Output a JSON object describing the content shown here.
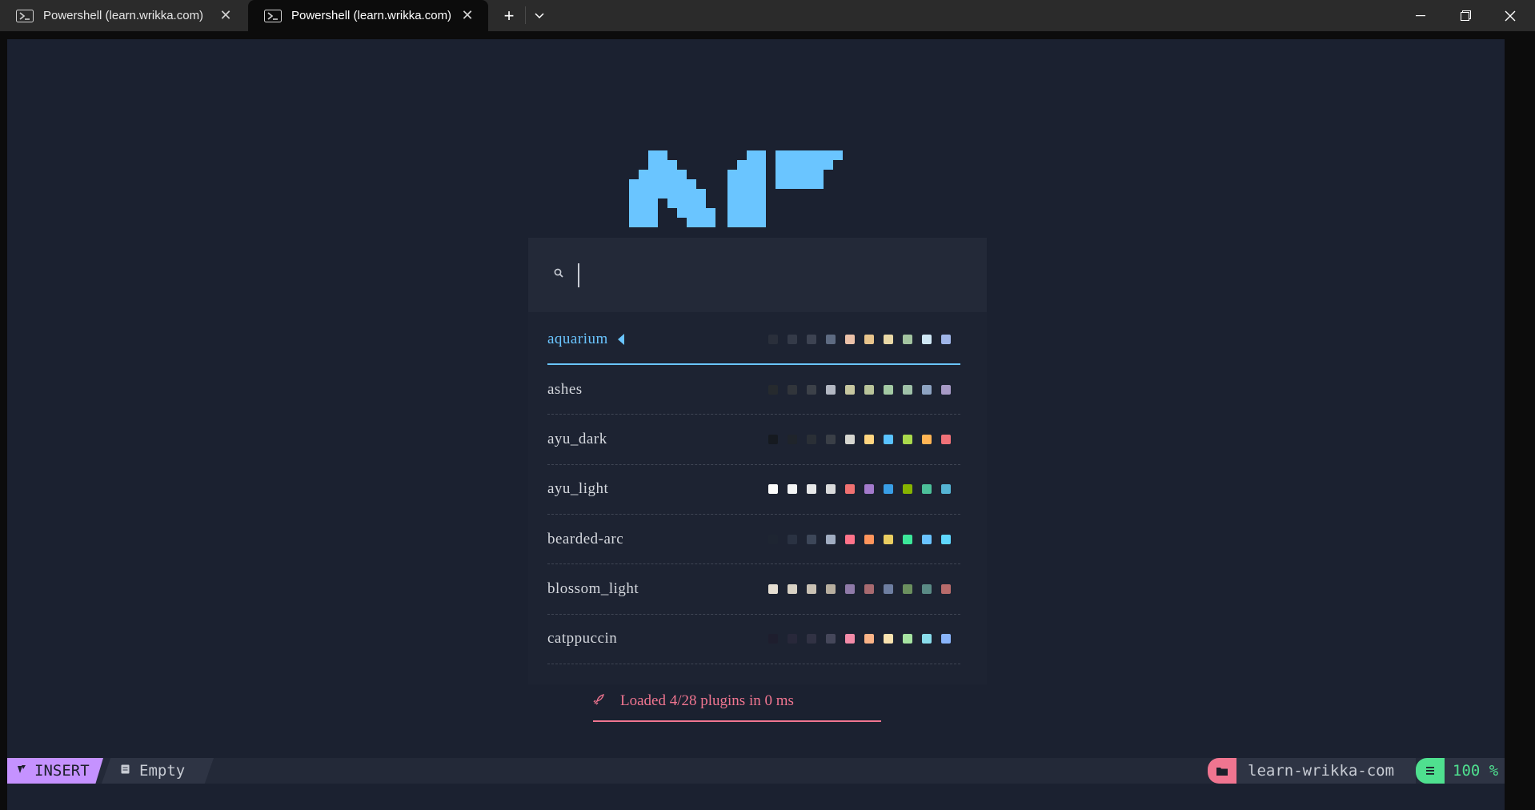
{
  "window": {
    "tabs": [
      {
        "label": "Powershell (learn.wrikka.com)",
        "active": false
      },
      {
        "label": "Powershell (learn.wrikka.com)",
        "active": true
      }
    ],
    "new_tab_icon": "+",
    "dropdown_icon": "chevron-down",
    "minimize_icon": "minimize",
    "restore_icon": "restore",
    "close_icon": "close"
  },
  "picker": {
    "prompt_icon": "search-icon",
    "prompt_value": "",
    "results": [
      {
        "name": "aquarium",
        "selected": true,
        "colors": [
          "#2a2f3b",
          "#343a48",
          "#3d4352",
          "#5e6b82",
          "#ebc1a9",
          "#e8c48c",
          "#e9d8a6",
          "#a3c4a0",
          "#cfe7f5",
          "#9fb5e8"
        ]
      },
      {
        "name": "ashes",
        "selected": false,
        "colors": [
          "#262a2e",
          "#31353b",
          "#3c4149",
          "#b3b8c3",
          "#c7c7a0",
          "#b9c49a",
          "#a3c9a3",
          "#9fc1a8",
          "#8da3c2",
          "#a79ac6"
        ]
      },
      {
        "name": "ayu_dark",
        "selected": false,
        "colors": [
          "#161a20",
          "#1f242b",
          "#2a2f36",
          "#3a3f47",
          "#d6d6d0",
          "#ffd580",
          "#59c2ff",
          "#aad94c",
          "#ffb454",
          "#f07178"
        ]
      },
      {
        "name": "ayu_light",
        "selected": false,
        "colors": [
          "#fcfcfc",
          "#f3f4f5",
          "#e7e8e9",
          "#d9dadb",
          "#f07171",
          "#a37acc",
          "#399ee6",
          "#86b300",
          "#4cbf99",
          "#55b4d4"
        ]
      },
      {
        "name": "bearded-arc",
        "selected": false,
        "colors": [
          "#1e2532",
          "#2a3242",
          "#3d4759",
          "#a1adc2",
          "#ff738a",
          "#ff955c",
          "#eacd61",
          "#3ce79a",
          "#69c3ff",
          "#5fd7ff"
        ]
      },
      {
        "name": "blossom_light",
        "selected": false,
        "colors": [
          "#e6dfd3",
          "#d8d1c4",
          "#c9c1b4",
          "#b7ae9f",
          "#8f7aa8",
          "#a86a70",
          "#6e7ea1",
          "#6b8f5e",
          "#5a8a85",
          "#b86b6b"
        ]
      },
      {
        "name": "catppuccin",
        "selected": false,
        "colors": [
          "#1e1e2e",
          "#28283a",
          "#313244",
          "#45475a",
          "#f38ba8",
          "#fab387",
          "#f9e2af",
          "#a6e3a1",
          "#89dceb",
          "#89b4fa"
        ]
      }
    ]
  },
  "loaded_message": "Loaded 4/28 plugins in 0 ms",
  "statusline": {
    "mode": "INSERT",
    "file": "Empty",
    "cwd": "learn-wrikka-com",
    "position": "100 %"
  }
}
